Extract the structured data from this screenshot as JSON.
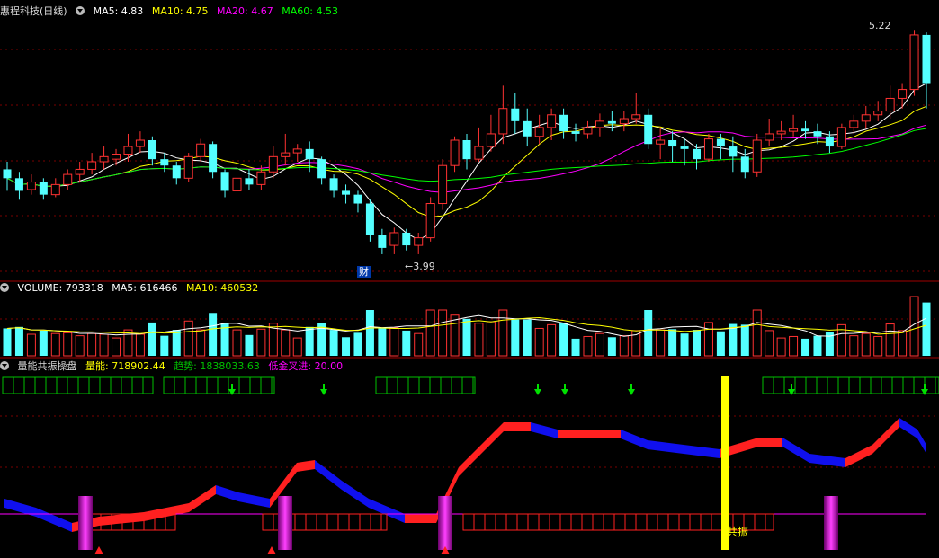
{
  "main": {
    "title": "惠程科技(日线)",
    "ma5": "MA5: 4.83",
    "ma10": "MA10: 4.75",
    "ma20": "MA20: 4.67",
    "ma60": "MA60: 4.53",
    "high_label": "5.22",
    "low_label": "3.99",
    "fin_badge": "财"
  },
  "volume": {
    "volume": "VOLUME: 793318",
    "ma5": "MA5: 616466",
    "ma10": "MA10: 460532"
  },
  "indicator": {
    "title": "量能共振操盘",
    "liang": "量能: 718902.44",
    "qushi": "趋势: 1838033.63",
    "dijin": "低金叉进: 20.00",
    "resonance_label": "共振"
  },
  "colors": {
    "up": "#ff3232",
    "down": "#54ffff",
    "ma5": "#ffffff",
    "ma10": "#ffff00",
    "ma20": "#ff00ff",
    "ma60": "#00ff00",
    "grid": "#7a0000",
    "border": "#a00000"
  },
  "chart_data": {
    "type": "candlestick",
    "price_range": [
      3.99,
      5.22
    ],
    "candles": [
      [
        4.12,
        4.05,
        4.18,
        3.95
      ],
      [
        4.05,
        3.95,
        4.1,
        3.88
      ],
      [
        3.96,
        4.02,
        4.08,
        3.92
      ],
      [
        4.02,
        3.92,
        4.05,
        3.88
      ],
      [
        3.92,
        4.0,
        4.05,
        3.9
      ],
      [
        4.0,
        4.08,
        4.12,
        3.96
      ],
      [
        4.08,
        4.12,
        4.18,
        4.02
      ],
      [
        4.12,
        4.18,
        4.25,
        4.08
      ],
      [
        4.18,
        4.22,
        4.3,
        4.12
      ],
      [
        4.2,
        4.24,
        4.28,
        4.15
      ],
      [
        4.24,
        4.3,
        4.4,
        4.18
      ],
      [
        4.3,
        4.35,
        4.42,
        4.25
      ],
      [
        4.35,
        4.2,
        4.38,
        4.15
      ],
      [
        4.2,
        4.15,
        4.25,
        4.1
      ],
      [
        4.15,
        4.05,
        4.18,
        4.0
      ],
      [
        4.05,
        4.22,
        4.25,
        4.02
      ],
      [
        4.22,
        4.32,
        4.36,
        4.18
      ],
      [
        4.32,
        4.1,
        4.34,
        4.05
      ],
      [
        4.1,
        3.95,
        4.12,
        3.9
      ],
      [
        3.95,
        4.05,
        4.1,
        3.92
      ],
      [
        4.05,
        4.0,
        4.12,
        3.96
      ],
      [
        4.0,
        4.1,
        4.15,
        3.96
      ],
      [
        4.1,
        4.22,
        4.3,
        4.05
      ],
      [
        4.22,
        4.25,
        4.4,
        4.15
      ],
      [
        4.25,
        4.28,
        4.32,
        4.18
      ],
      [
        4.28,
        4.2,
        4.34,
        4.1
      ],
      [
        4.2,
        4.05,
        4.22,
        4.0
      ],
      [
        4.05,
        3.95,
        4.08,
        3.9
      ],
      [
        3.95,
        3.92,
        4.0,
        3.85
      ],
      [
        3.92,
        3.85,
        3.95,
        3.78
      ],
      [
        3.85,
        3.6,
        3.88,
        3.55
      ],
      [
        3.6,
        3.5,
        3.65,
        3.45
      ],
      [
        3.52,
        3.62,
        3.66,
        3.45
      ],
      [
        3.62,
        3.52,
        3.65,
        3.48
      ],
      [
        3.52,
        3.58,
        3.62,
        3.45
      ],
      [
        3.58,
        3.85,
        3.9,
        3.55
      ],
      [
        3.85,
        4.15,
        4.2,
        3.8
      ],
      [
        4.15,
        4.35,
        4.38,
        4.1
      ],
      [
        4.35,
        4.2,
        4.4,
        4.12
      ],
      [
        4.2,
        4.3,
        4.45,
        4.18
      ],
      [
        4.3,
        4.4,
        4.55,
        4.26
      ],
      [
        4.4,
        4.6,
        4.78,
        4.32
      ],
      [
        4.6,
        4.5,
        4.72,
        4.4
      ],
      [
        4.5,
        4.38,
        4.6,
        4.3
      ],
      [
        4.38,
        4.45,
        4.55,
        4.32
      ],
      [
        4.45,
        4.55,
        4.6,
        4.35
      ],
      [
        4.55,
        4.42,
        4.6,
        4.36
      ],
      [
        4.42,
        4.4,
        4.48,
        4.34
      ],
      [
        4.4,
        4.45,
        4.5,
        4.36
      ],
      [
        4.45,
        4.5,
        4.56,
        4.38
      ],
      [
        4.5,
        4.48,
        4.58,
        4.42
      ],
      [
        4.48,
        4.52,
        4.58,
        4.42
      ],
      [
        4.52,
        4.55,
        4.72,
        4.48
      ],
      [
        4.55,
        4.32,
        4.6,
        4.28
      ],
      [
        4.32,
        4.35,
        4.45,
        4.2
      ],
      [
        4.35,
        4.3,
        4.42,
        4.18
      ],
      [
        4.3,
        4.28,
        4.36,
        4.15
      ],
      [
        4.28,
        4.2,
        4.32,
        4.12
      ],
      [
        4.2,
        4.36,
        4.4,
        4.18
      ],
      [
        4.36,
        4.3,
        4.4,
        4.2
      ],
      [
        4.3,
        4.22,
        4.38,
        4.1
      ],
      [
        4.22,
        4.1,
        4.28,
        4.05
      ],
      [
        4.1,
        4.35,
        4.4,
        4.06
      ],
      [
        4.35,
        4.4,
        4.52,
        4.3
      ],
      [
        4.4,
        4.42,
        4.5,
        4.35
      ],
      [
        4.42,
        4.44,
        4.55,
        4.38
      ],
      [
        4.44,
        4.42,
        4.5,
        4.36
      ],
      [
        4.42,
        4.38,
        4.48,
        4.32
      ],
      [
        4.38,
        4.3,
        4.42,
        4.25
      ],
      [
        4.3,
        4.45,
        4.48,
        4.28
      ],
      [
        4.45,
        4.5,
        4.55,
        4.4
      ],
      [
        4.5,
        4.55,
        4.62,
        4.44
      ],
      [
        4.55,
        4.58,
        4.66,
        4.5
      ],
      [
        4.58,
        4.68,
        4.78,
        4.52
      ],
      [
        4.68,
        4.75,
        4.8,
        4.6
      ],
      [
        4.75,
        5.18,
        5.22,
        4.7
      ],
      [
        5.18,
        4.8,
        5.2,
        4.6
      ]
    ]
  }
}
